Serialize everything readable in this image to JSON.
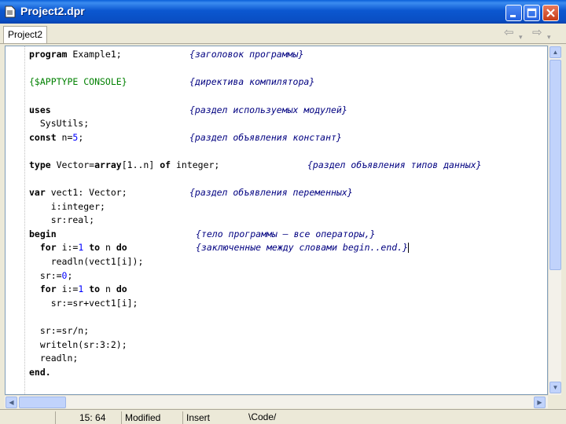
{
  "window": {
    "title": "Project2.dpr"
  },
  "tabs": [
    {
      "label": "Project2"
    }
  ],
  "code": {
    "l1": {
      "code": "program Example1;",
      "comment": "{заголовок программы}"
    },
    "l2": {
      "code": "{$APPTYPE CONSOLE}",
      "comment": "{директива компилятора}"
    },
    "l3": {
      "code": "uses",
      "comment": "{раздел используемых модулей}"
    },
    "l4": {
      "code": "  SysUtils;"
    },
    "l5": {
      "kw": "const",
      "rest": " n=",
      "num": "5",
      "end": ";",
      "comment": "{раздел объявления констант}"
    },
    "l6": {
      "kw1": "type",
      "mid": " Vector=",
      "kw2": "array",
      "mid2": "[1..n] ",
      "kw3": "of",
      "end": " integer;",
      "comment": "{раздел объявления типов данных}"
    },
    "l7": {
      "kw": "var",
      "rest": " vect1: Vector;",
      "comment": "{раздел объявления переменных}"
    },
    "l8": {
      "code": "    i:integer;"
    },
    "l9": {
      "code": "    sr:real;"
    },
    "l10": {
      "code": "begin",
      "comment": "{тело программы – все операторы,}"
    },
    "l11": {
      "kw1": "for",
      "mid": " i:=",
      "num": "1",
      "sp": " ",
      "kw2": "to",
      "mid2": " n ",
      "kw3": "do",
      "comment": "{заключенные между словами begin..end.}"
    },
    "l12": {
      "code": "    readln(vect1[i]);"
    },
    "l13": {
      "pre": "  sr:=",
      "num": "0",
      "end": ";"
    },
    "l14": {
      "kw1": "for",
      "mid": " i:=",
      "num": "1",
      "sp": " ",
      "kw2": "to",
      "mid2": " n ",
      "kw3": "do"
    },
    "l15": {
      "code": "    sr:=sr+vect1[i];"
    },
    "l16": {
      "code": "  sr:=sr/n;"
    },
    "l17": {
      "code": "  writeln(sr:3:2);"
    },
    "l18": {
      "code": "  readln;"
    },
    "l19": {
      "code": "end."
    }
  },
  "status": {
    "position": "15:  64",
    "state": "Modified",
    "mode": "Insert",
    "view_tab": "Code"
  }
}
